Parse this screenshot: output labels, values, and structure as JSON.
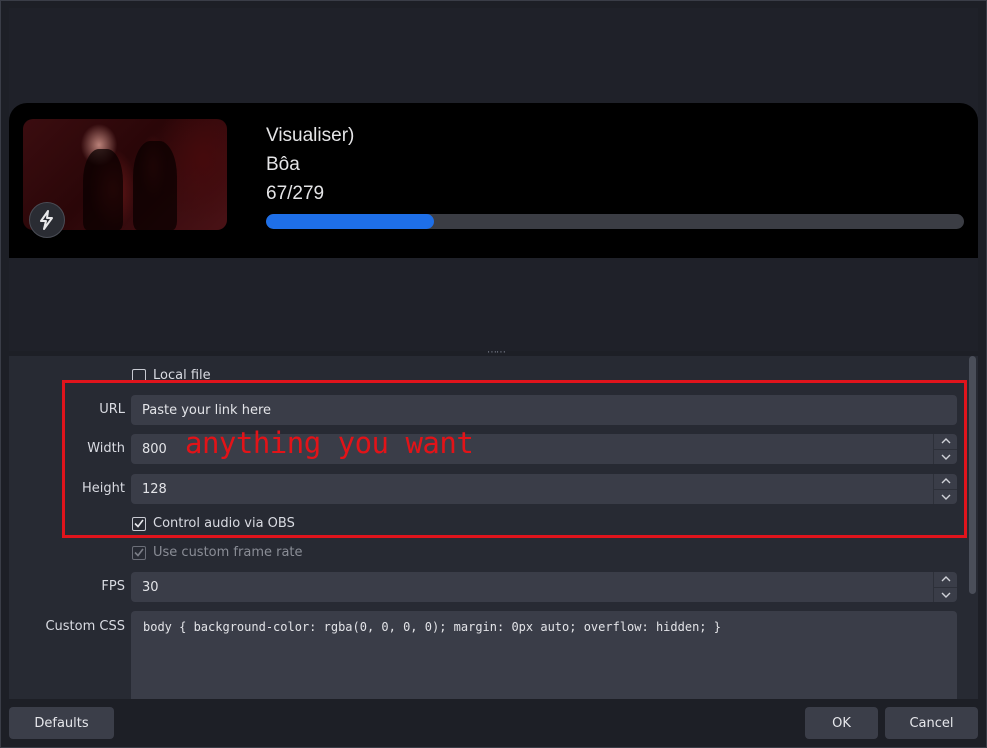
{
  "widget": {
    "title_line": "Visualiser)",
    "artist": "Bôa",
    "track_position": "67/279",
    "progress_fraction": 0.24,
    "accent_color": "#1e6fe8",
    "badge_icon": "lightning-bolt-icon"
  },
  "properties": {
    "local_file_label": "Local file",
    "local_file_checked": false,
    "url_label": "URL",
    "url_value": "Paste your link here",
    "width_label": "Width",
    "width_value": "800",
    "height_label": "Height",
    "height_value": "128",
    "control_audio_label": "Control audio via OBS",
    "control_audio_checked": true,
    "custom_frame_rate_label": "Use custom frame rate",
    "custom_frame_rate_checked": true,
    "fps_label": "FPS",
    "fps_value": "30",
    "custom_css_label": "Custom CSS",
    "custom_css_value": "body { background-color: rgba(0, 0, 0, 0); margin: 0px auto; overflow: hidden; }"
  },
  "annotation": {
    "text": "anything you want",
    "color": "#e0141c"
  },
  "footer": {
    "defaults_label": "Defaults",
    "ok_label": "OK",
    "cancel_label": "Cancel"
  }
}
